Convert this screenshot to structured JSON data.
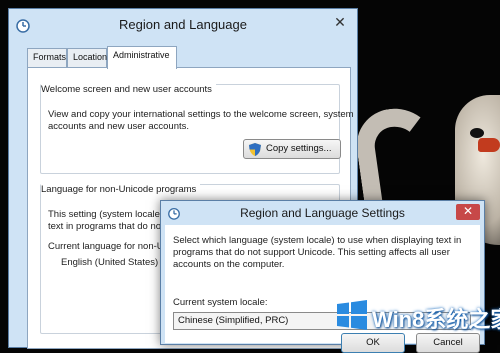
{
  "main_dialog": {
    "title": "Region and Language",
    "close_label": "✕",
    "tabs": [
      {
        "label": "Formats",
        "active": false
      },
      {
        "label": "Location",
        "active": false
      },
      {
        "label": "Administrative",
        "active": true
      }
    ],
    "welcome_group": {
      "title": "Welcome screen and new user accounts",
      "line1": "View and copy your international settings to the welcome screen, system",
      "line2": "accounts and new user accounts.",
      "copy_button_label": "Copy settings..."
    },
    "unicode_group": {
      "title": "Language for non-Unicode programs",
      "line1": "This setting (system locale) controls the language used when displaying",
      "line2": "text in programs that do not s",
      "current_label": "Current language for non-Unic",
      "current_value": "English (United States)"
    }
  },
  "settings_dialog": {
    "title": "Region and Language Settings",
    "close_label": "✕",
    "description": "Select which language (system locale) to use when displaying text in programs that do not support Unicode. This setting affects all user accounts on the computer.",
    "locale_label": "Current system locale:",
    "locale_value": "Chinese (Simplified, PRC)",
    "ok_label": "OK",
    "cancel_label": "Cancel"
  },
  "watermark": {
    "text": "Win8系统之家"
  },
  "icons": {
    "app_icon": "globe-clock-icon",
    "shield": "uac-shield-icon",
    "logo": "windows-logo-icon"
  },
  "colors": {
    "window_frame": "#cfe3f5",
    "close_red": "#c74848",
    "watermark_blue": "#1a6fc4"
  }
}
